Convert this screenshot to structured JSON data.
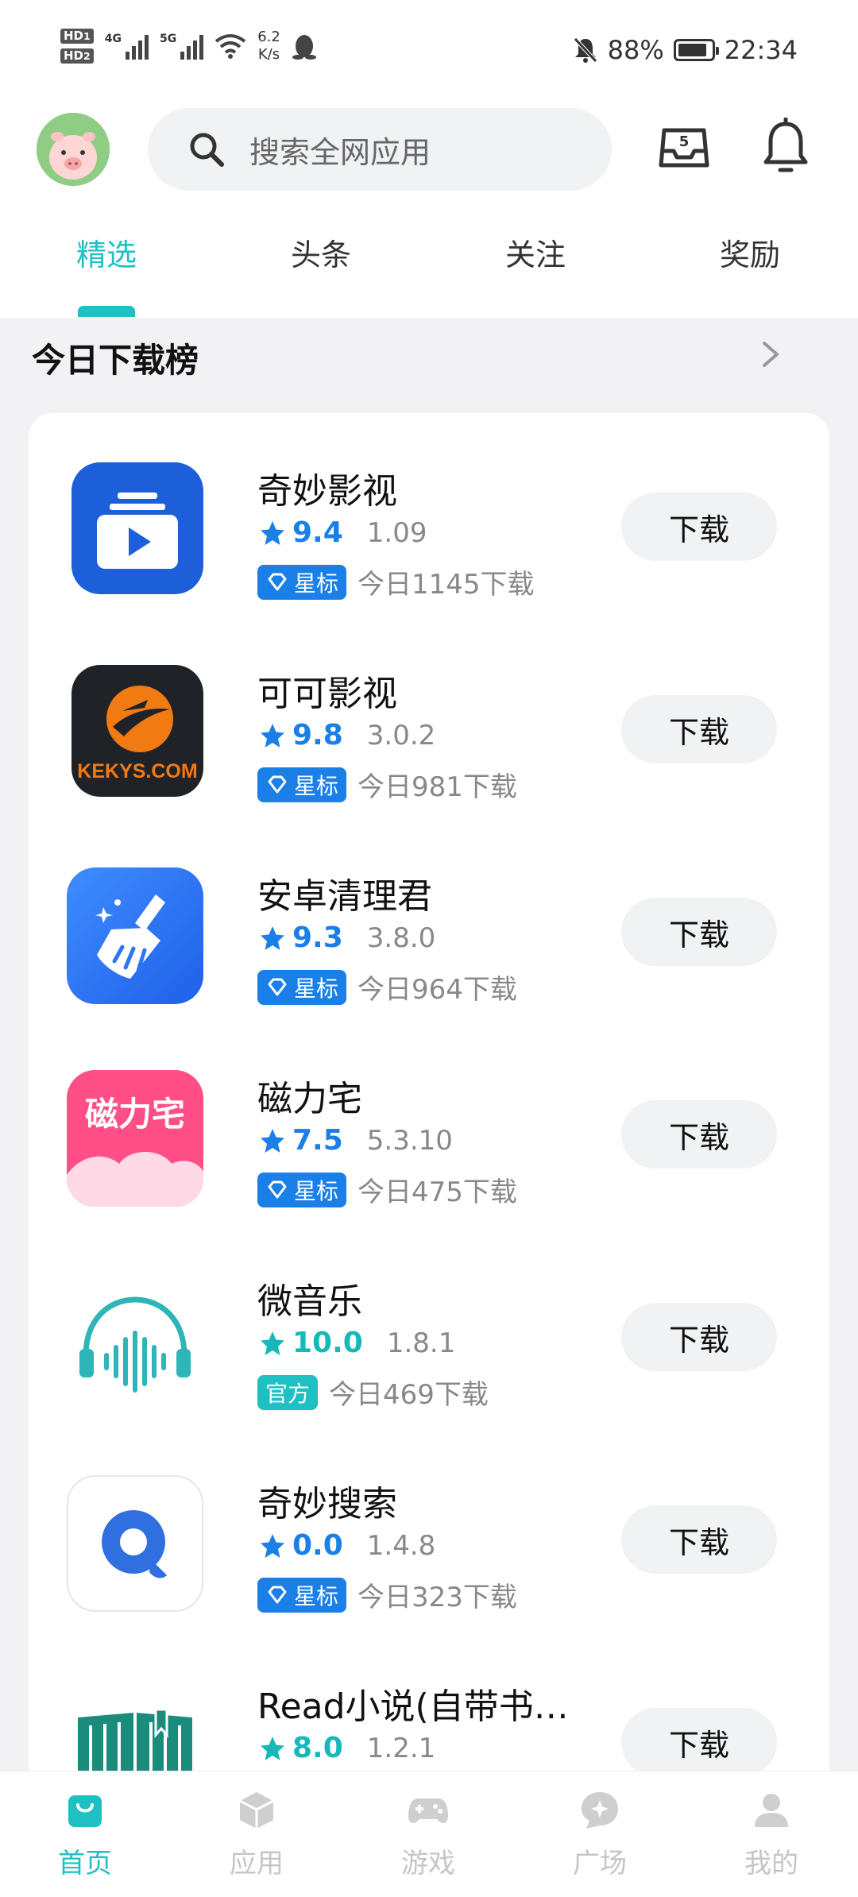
{
  "status_bar": {
    "hd1": "HD",
    "hd1_sub": "1",
    "hd2": "HD",
    "hd2_sub": "2",
    "net1": "4G",
    "net2": "5G",
    "speed_value": "6.2",
    "speed_unit": "K/s",
    "battery": "88%",
    "time": "22:34"
  },
  "header": {
    "search_placeholder": "搜索全网应用",
    "inbox_count": "5"
  },
  "tabs": [
    {
      "label": "精选",
      "active": true
    },
    {
      "label": "头条",
      "active": false
    },
    {
      "label": "关注",
      "active": false
    },
    {
      "label": "奖励",
      "active": false
    }
  ],
  "section": {
    "title": "今日下载榜"
  },
  "apps": [
    {
      "name": "奇妙影视",
      "rating": "9.4",
      "version": "1.09",
      "badge": "星标",
      "downloads": "今日1145下载",
      "button": "下载",
      "icon": "video-play-icon"
    },
    {
      "name": "可可影视",
      "rating": "9.8",
      "version": "3.0.2",
      "badge": "星标",
      "downloads": "今日981下载",
      "button": "下载",
      "icon": "kekys-icon",
      "icon_text": "KEKYS.COM"
    },
    {
      "name": "安卓清理君",
      "rating": "9.3",
      "version": "3.8.0",
      "badge": "星标",
      "downloads": "今日964下载",
      "button": "下载",
      "icon": "broom-icon"
    },
    {
      "name": "磁力宅",
      "rating": "7.5",
      "version": "5.3.10",
      "badge": "星标",
      "downloads": "今日475下载",
      "button": "下载",
      "icon": "cilizhai-icon",
      "icon_text": "磁力宅"
    },
    {
      "name": "微音乐",
      "rating": "10.0",
      "version": "1.8.1",
      "badge": "官方",
      "downloads": "今日469下载",
      "button": "下载",
      "icon": "headphones-icon"
    },
    {
      "name": "奇妙搜索",
      "rating": "0.0",
      "version": "1.4.8",
      "badge": "星标",
      "downloads": "今日323下载",
      "button": "下载",
      "icon": "search-q-icon"
    },
    {
      "name": "Read小说(自带书…",
      "rating": "8.0",
      "version": "1.2.1",
      "button": "下载",
      "icon": "book-icon"
    }
  ],
  "bottom_nav": [
    {
      "label": "首页",
      "active": true
    },
    {
      "label": "应用",
      "active": false
    },
    {
      "label": "游戏",
      "active": false
    },
    {
      "label": "广场",
      "active": false
    },
    {
      "label": "我的",
      "active": false
    }
  ],
  "colors": {
    "accent": "#1ec0c4",
    "rating_blue": "#1a7fe6",
    "rating_teal": "#18b8b8"
  }
}
